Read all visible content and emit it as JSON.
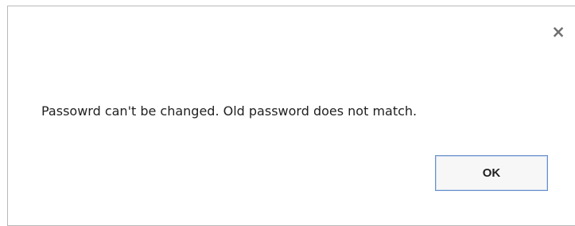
{
  "dialog": {
    "title": "",
    "message": "Passowrd can't be changed. Old password does not match.",
    "ok_label": "OK",
    "close_symbol": "×",
    "close_icon": "close-icon"
  }
}
